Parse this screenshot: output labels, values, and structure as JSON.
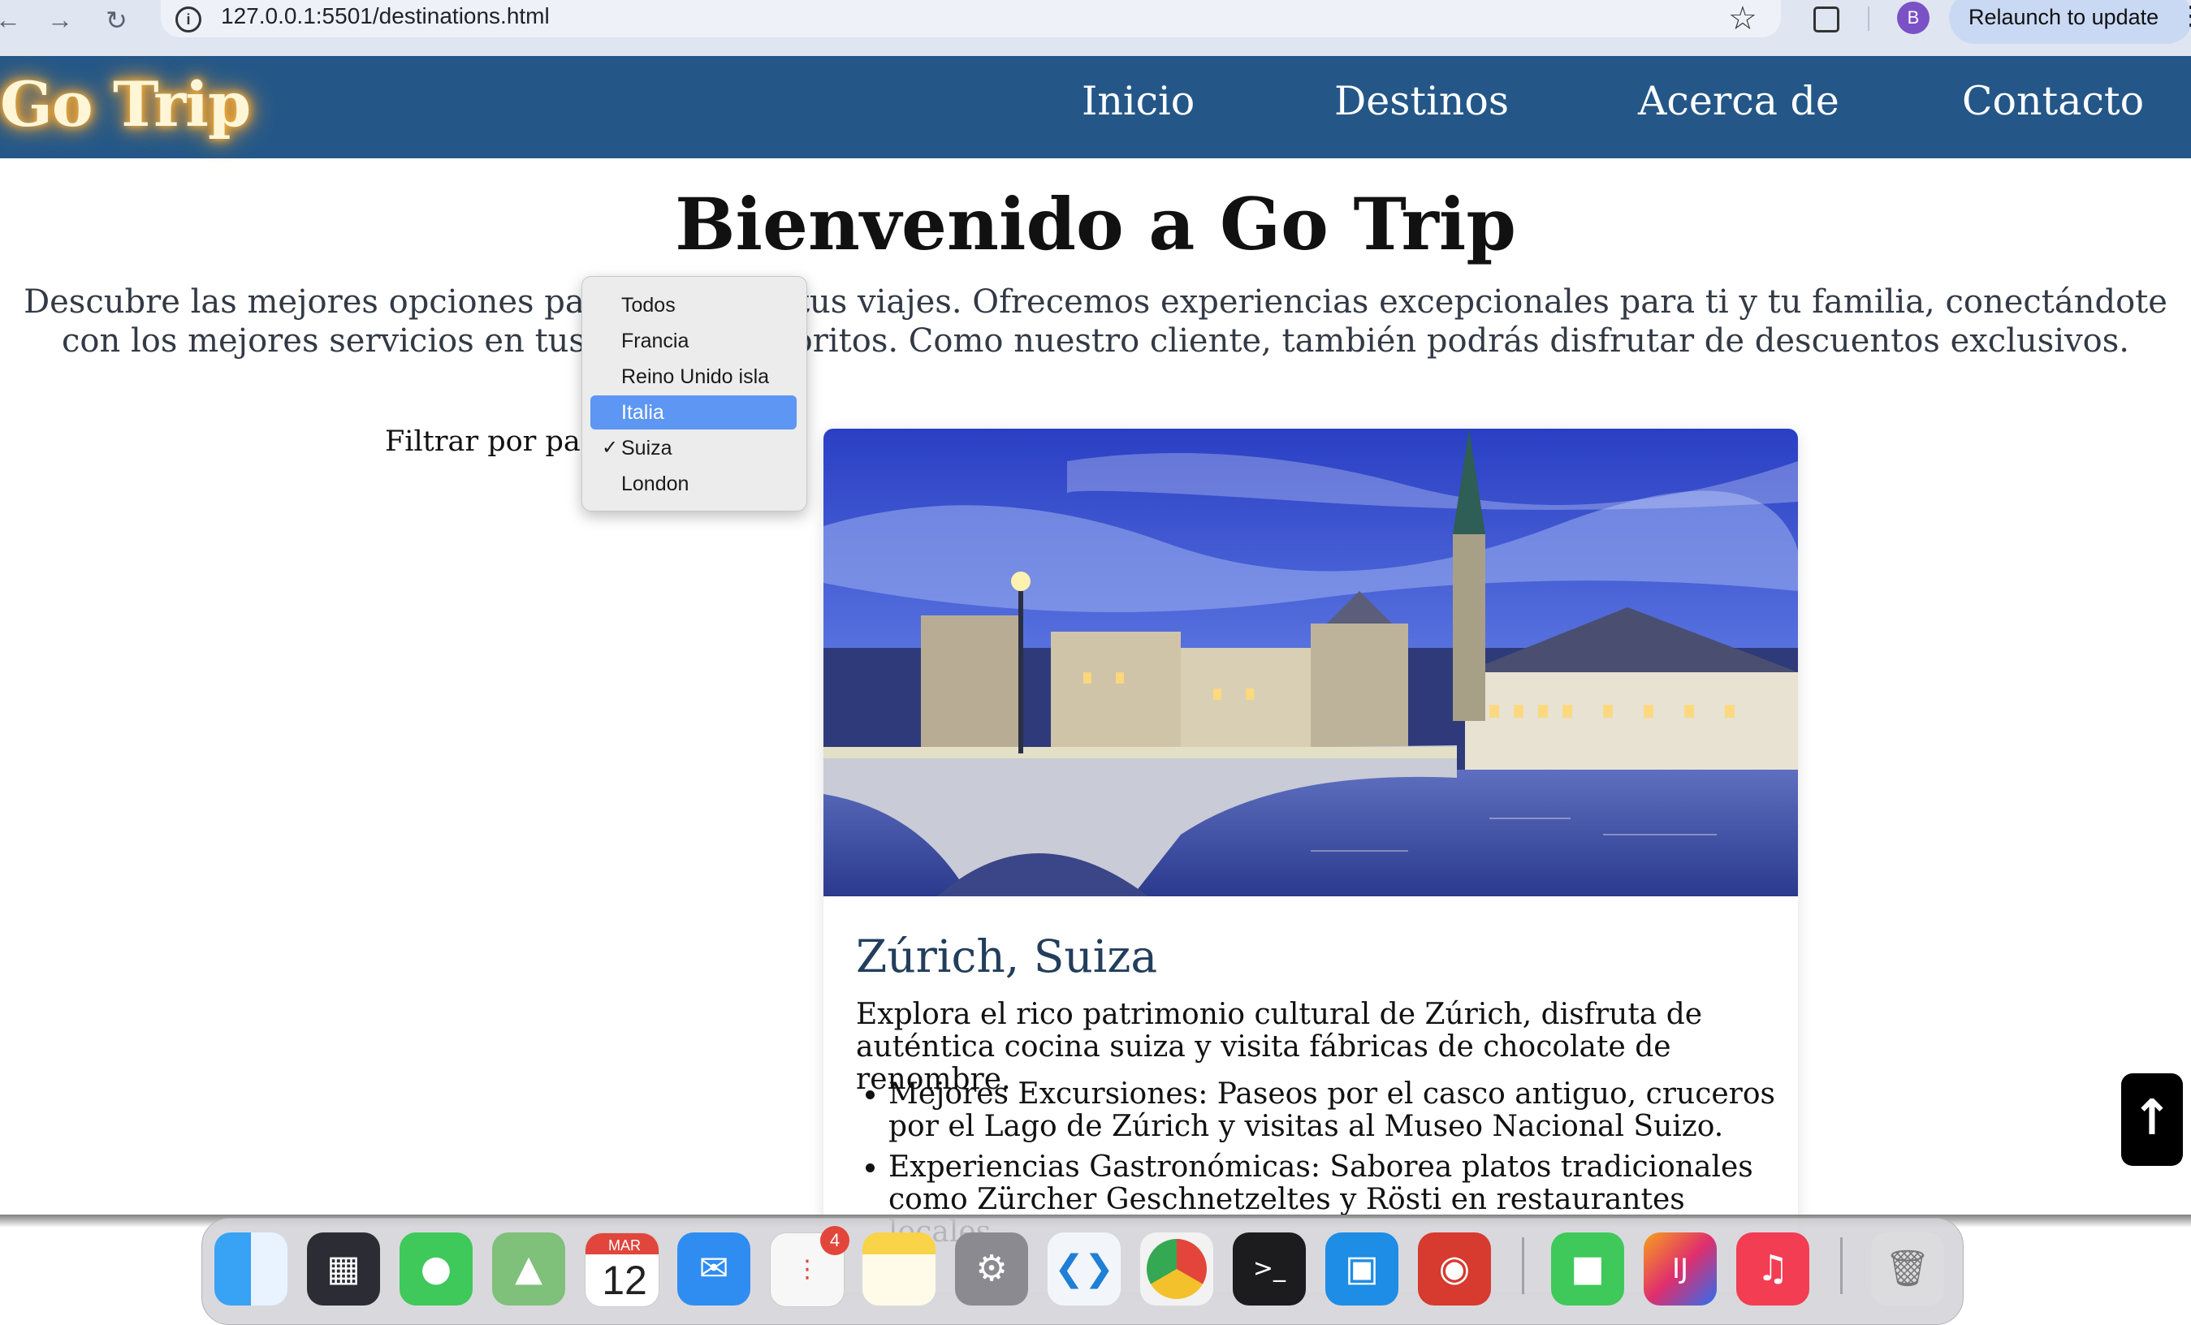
{
  "browser": {
    "url": "127.0.0.1:5501/destinations.html",
    "back_icon": "arrow-left-icon",
    "forward_icon": "arrow-right-icon",
    "reload_icon": "reload-icon",
    "profile_initial": "B",
    "relaunch_label": "Relaunch to update"
  },
  "header": {
    "logo": "Go Trip",
    "nav": [
      "Inicio",
      "Destinos",
      "Acerca de",
      "Contacto"
    ],
    "bg_color": "#245788"
  },
  "main": {
    "title": "Bienvenido a Go Trip",
    "intro": "Descubre las mejores opciones para planificar tus viajes. Ofrecemos experiencias excepcionales para ti y tu familia, conectándote con los mejores servicios en tus destinos favoritos. Como nuestro cliente, también podrás disfrutar de descuentos exclusivos.",
    "filter_label": "Filtrar por país:"
  },
  "dropdown": {
    "options": [
      "Todos",
      "Francia",
      "Reino Unido isla",
      "Italia",
      "Suiza",
      "London"
    ],
    "highlighted": "Italia",
    "selected": "Suiza",
    "check_glyph": "✓"
  },
  "card": {
    "title": "Zúrich, Suiza",
    "description": "Explora el rico patrimonio cultural de Zúrich, disfruta de auténtica cocina suiza y visita fábricas de chocolate de renombre.",
    "bullets": [
      "Mejores Excursiones: Paseos por el casco antiguo, cruceros por el Lago de Zúrich y visitas al Museo Nacional Suizo.",
      "Experiencias Gastronómicas: Saborea platos tradicionales como Zürcher Geschnetzeltes y Rösti en restaurantes locales."
    ]
  },
  "scroll_top": {
    "icon": "arrow-up-icon",
    "glyph": "↑"
  },
  "dock": {
    "calendar_month": "MAR",
    "calendar_day": "12",
    "reminders_badge": "4",
    "apps": [
      "finder-icon",
      "launchpad-icon",
      "messages-icon",
      "maps-icon",
      "calendar-icon",
      "mail-icon",
      "reminders-icon",
      "notes-icon",
      "system-settings-icon",
      "vscode-icon",
      "chrome-icon",
      "terminal-icon",
      "docker-icon",
      "photo-booth-icon",
      "facetime-icon",
      "intellij-icon",
      "music-icon",
      "trash-icon"
    ]
  }
}
